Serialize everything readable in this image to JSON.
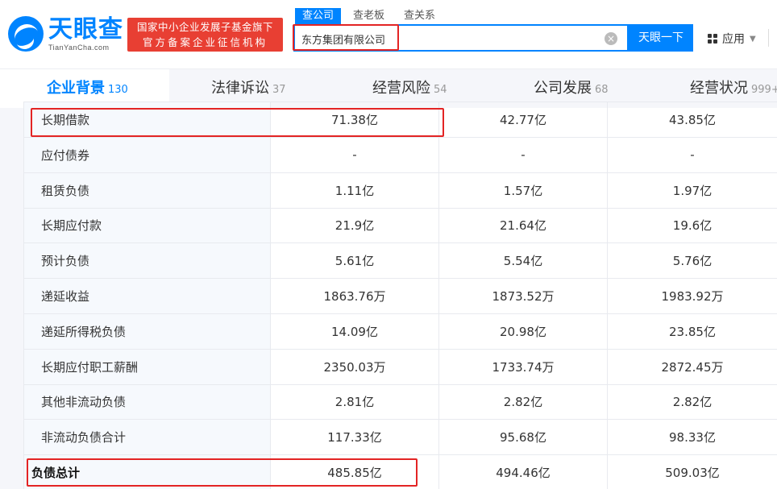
{
  "header": {
    "logo_name": "天眼查",
    "logo_domain": "TianYanCha.com",
    "badge_line1": "国家中小企业发展子基金旗下",
    "badge_line2": "官方备案企业征信机构",
    "search_tabs": [
      "查公司",
      "查老板",
      "查关系"
    ],
    "search_value": "东方集团有限公司",
    "search_button": "天眼一下",
    "apps_label": "应用",
    "accent_color": "#0084ff",
    "badge_color": "#e83f33"
  },
  "nav": {
    "tabs": [
      {
        "label": "企业背景",
        "count": "130"
      },
      {
        "label": "法律诉讼",
        "count": "37"
      },
      {
        "label": "经营风险",
        "count": "54"
      },
      {
        "label": "公司发展",
        "count": "68"
      },
      {
        "label": "经营状况",
        "count": "999+"
      }
    ]
  },
  "table": {
    "rows": [
      {
        "label": "长期借款",
        "values": [
          "71.38亿",
          "42.77亿",
          "43.85亿"
        ]
      },
      {
        "label": "应付债券",
        "values": [
          "-",
          "-",
          "-"
        ]
      },
      {
        "label": "租赁负债",
        "values": [
          "1.11亿",
          "1.57亿",
          "1.97亿"
        ]
      },
      {
        "label": "长期应付款",
        "values": [
          "21.9亿",
          "21.64亿",
          "19.6亿"
        ]
      },
      {
        "label": "预计负债",
        "values": [
          "5.61亿",
          "5.54亿",
          "5.76亿"
        ]
      },
      {
        "label": "递延收益",
        "values": [
          "1863.76万",
          "1873.52万",
          "1983.92万"
        ]
      },
      {
        "label": "递延所得税负债",
        "values": [
          "14.09亿",
          "20.98亿",
          "23.85亿"
        ]
      },
      {
        "label": "长期应付职工薪酬",
        "values": [
          "2350.03万",
          "1733.74万",
          "2872.45万"
        ]
      },
      {
        "label": "其他非流动负债",
        "values": [
          "2.81亿",
          "2.82亿",
          "2.82亿"
        ]
      },
      {
        "label": "非流动负债合计",
        "values": [
          "117.33亿",
          "95.68亿",
          "98.33亿"
        ]
      },
      {
        "label": "负债总计",
        "values": [
          "485.85亿",
          "494.46亿",
          "509.03亿"
        ]
      }
    ]
  }
}
